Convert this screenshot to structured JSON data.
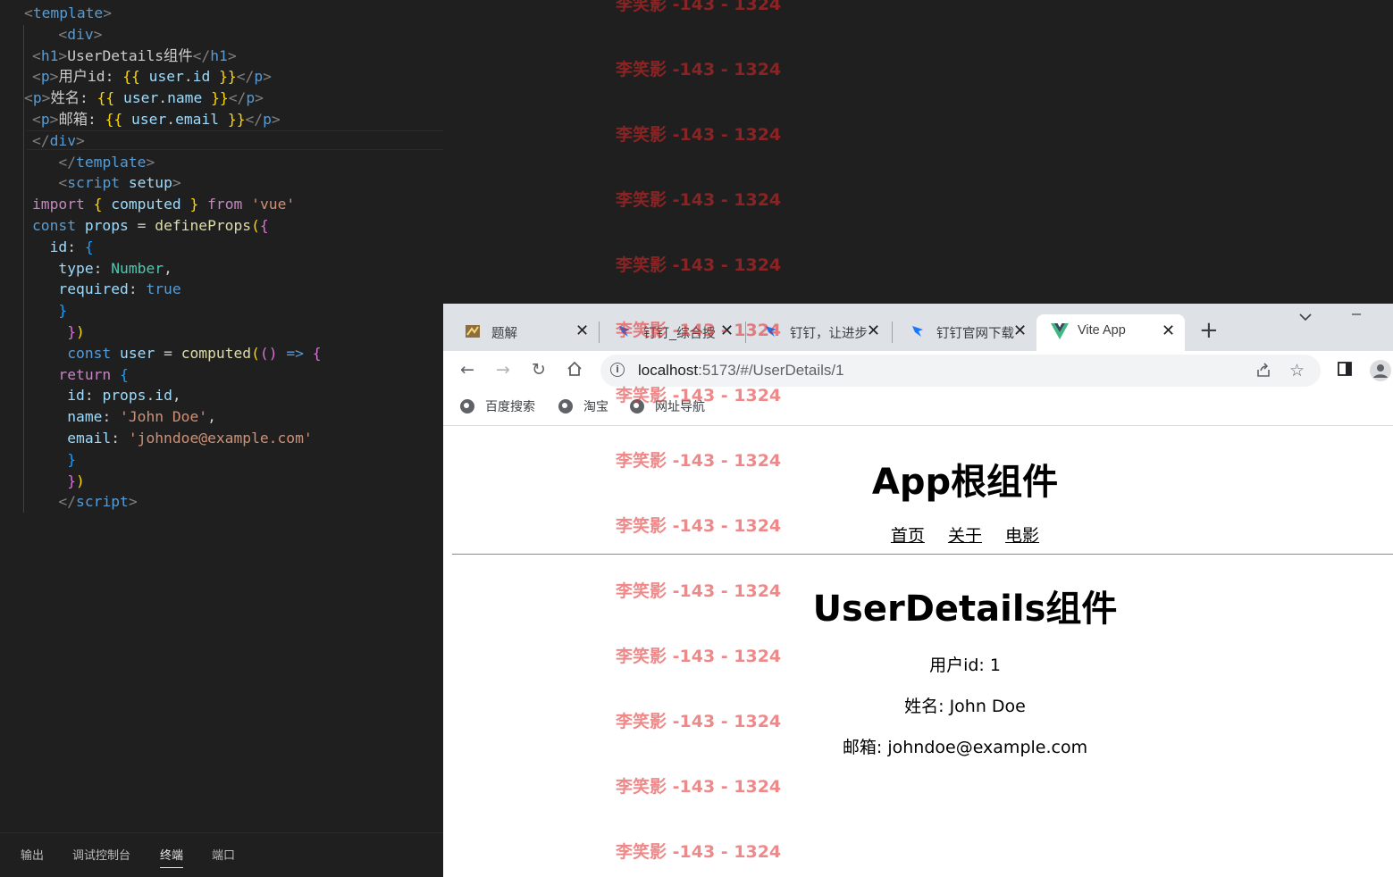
{
  "editor": {
    "lines": [
      [
        [
          "tok-punc",
          "<"
        ],
        [
          "tok-tag",
          "template"
        ],
        [
          "tok-punc",
          ">"
        ]
      ],
      [
        [
          "tok-text",
          "   "
        ],
        [
          "tok-punc",
          "<"
        ],
        [
          "tok-tag",
          "div"
        ],
        [
          "tok-punc",
          ">"
        ]
      ],
      [
        [
          "tok-punc",
          "<"
        ],
        [
          "tok-tag",
          "h1"
        ],
        [
          "tok-punc",
          ">"
        ],
        [
          "tok-text",
          "UserDetails组件"
        ],
        [
          "tok-punc",
          "</"
        ],
        [
          "tok-tag",
          "h1"
        ],
        [
          "tok-punc",
          ">"
        ]
      ],
      [
        [
          "tok-punc",
          "<"
        ],
        [
          "tok-tag",
          "p"
        ],
        [
          "tok-punc",
          ">"
        ],
        [
          "tok-text",
          "用户id: "
        ],
        [
          "tok-brace",
          "{{"
        ],
        [
          "tok-text",
          " "
        ],
        [
          "tok-var",
          "user"
        ],
        [
          "tok-text",
          "."
        ],
        [
          "tok-var",
          "id"
        ],
        [
          "tok-text",
          " "
        ],
        [
          "tok-brace",
          "}}"
        ],
        [
          "tok-punc",
          "</"
        ],
        [
          "tok-tag",
          "p"
        ],
        [
          "tok-punc",
          ">"
        ]
      ],
      [
        [
          "tok-punc",
          "<"
        ],
        [
          "tok-tag",
          "p"
        ],
        [
          "tok-punc",
          ">"
        ],
        [
          "tok-text",
          "姓名: "
        ],
        [
          "tok-brace",
          "{{"
        ],
        [
          "tok-text",
          " "
        ],
        [
          "tok-var",
          "user"
        ],
        [
          "tok-text",
          "."
        ],
        [
          "tok-var",
          "name"
        ],
        [
          "tok-text",
          " "
        ],
        [
          "tok-brace",
          "}}"
        ],
        [
          "tok-punc",
          "</"
        ],
        [
          "tok-tag",
          "p"
        ],
        [
          "tok-punc",
          ">"
        ]
      ],
      [
        [
          "tok-punc",
          "<"
        ],
        [
          "tok-tag",
          "p"
        ],
        [
          "tok-punc",
          ">"
        ],
        [
          "tok-text",
          "邮箱: "
        ],
        [
          "tok-brace",
          "{{"
        ],
        [
          "tok-text",
          " "
        ],
        [
          "tok-var",
          "user"
        ],
        [
          "tok-text",
          "."
        ],
        [
          "tok-var",
          "email"
        ],
        [
          "tok-text",
          " "
        ],
        [
          "tok-brace",
          "}}"
        ],
        [
          "tok-punc",
          "</"
        ],
        [
          "tok-tag",
          "p"
        ],
        [
          "tok-punc",
          ">"
        ]
      ],
      [
        [
          "tok-punc",
          "</"
        ],
        [
          "tok-tag",
          "div"
        ],
        [
          "tok-punc",
          ">"
        ]
      ],
      [
        [
          "tok-text",
          "   "
        ],
        [
          "tok-punc",
          "</"
        ],
        [
          "tok-tag",
          "template"
        ],
        [
          "tok-punc",
          ">"
        ]
      ],
      [
        [
          "tok-text",
          "   "
        ],
        [
          "tok-punc",
          "<"
        ],
        [
          "tok-tag",
          "script"
        ],
        [
          "tok-text",
          " "
        ],
        [
          "tok-attr",
          "setup"
        ],
        [
          "tok-punc",
          ">"
        ]
      ],
      [
        [
          "tok-kw",
          "import"
        ],
        [
          "tok-text",
          " "
        ],
        [
          "tok-brace",
          "{"
        ],
        [
          "tok-text",
          " "
        ],
        [
          "tok-var",
          "computed"
        ],
        [
          "tok-text",
          " "
        ],
        [
          "tok-brace",
          "}"
        ],
        [
          "tok-text",
          " "
        ],
        [
          "tok-kw",
          "from"
        ],
        [
          "tok-text",
          " "
        ],
        [
          "tok-str",
          "'vue'"
        ]
      ],
      [
        [
          "tok-const",
          "const"
        ],
        [
          "tok-text",
          " "
        ],
        [
          "tok-var",
          "props"
        ],
        [
          "tok-text",
          " = "
        ],
        [
          "tok-fn",
          "defineProps"
        ],
        [
          "tok-brace",
          "("
        ],
        [
          "tok-paren",
          "{"
        ]
      ],
      [
        [
          "tok-text",
          "  "
        ],
        [
          "tok-var",
          "id"
        ],
        [
          "tok-text",
          ": "
        ],
        [
          "tok-blue",
          "{"
        ]
      ],
      [
        [
          "tok-text",
          "   "
        ],
        [
          "tok-var",
          "type"
        ],
        [
          "tok-text",
          ": "
        ],
        [
          "tok-type",
          "Number"
        ],
        [
          "tok-text",
          ","
        ]
      ],
      [
        [
          "tok-text",
          "   "
        ],
        [
          "tok-var",
          "required"
        ],
        [
          "tok-text",
          ": "
        ],
        [
          "tok-const",
          "true"
        ]
      ],
      [
        [
          "tok-text",
          "   "
        ],
        [
          "tok-blue",
          "}"
        ]
      ],
      [
        [
          "tok-text",
          "    "
        ],
        [
          "tok-paren",
          "}"
        ],
        [
          "tok-brace",
          ")"
        ]
      ],
      [
        [
          "tok-text",
          "    "
        ],
        [
          "tok-const",
          "const"
        ],
        [
          "tok-text",
          " "
        ],
        [
          "tok-var",
          "user"
        ],
        [
          "tok-text",
          " = "
        ],
        [
          "tok-fn",
          "computed"
        ],
        [
          "tok-brace",
          "("
        ],
        [
          "tok-paren",
          "()"
        ],
        [
          "tok-text",
          " "
        ],
        [
          "tok-const",
          "=>"
        ],
        [
          "tok-text",
          " "
        ],
        [
          "tok-paren",
          "{"
        ]
      ],
      [
        [
          "tok-text",
          "   "
        ],
        [
          "tok-kw",
          "return"
        ],
        [
          "tok-text",
          " "
        ],
        [
          "tok-blue",
          "{"
        ]
      ],
      [
        [
          "tok-text",
          "    "
        ],
        [
          "tok-var",
          "id"
        ],
        [
          "tok-text",
          ": "
        ],
        [
          "tok-var",
          "props"
        ],
        [
          "tok-text",
          "."
        ],
        [
          "tok-var",
          "id"
        ],
        [
          "tok-text",
          ","
        ]
      ],
      [
        [
          "tok-text",
          "    "
        ],
        [
          "tok-var",
          "name"
        ],
        [
          "tok-text",
          ": "
        ],
        [
          "tok-str",
          "'John Doe'"
        ],
        [
          "tok-text",
          ","
        ]
      ],
      [
        [
          "tok-text",
          "    "
        ],
        [
          "tok-var",
          "email"
        ],
        [
          "tok-text",
          ": "
        ],
        [
          "tok-str",
          "'johndoe@example.com'"
        ]
      ],
      [
        [
          "tok-text",
          "    "
        ],
        [
          "tok-blue",
          "}"
        ]
      ],
      [
        [
          "tok-text",
          "    "
        ],
        [
          "tok-paren",
          "}"
        ],
        [
          "tok-brace",
          ")"
        ]
      ],
      [
        [
          "tok-text",
          "   "
        ],
        [
          "tok-punc",
          "</"
        ],
        [
          "tok-tag",
          "script"
        ],
        [
          "tok-punc",
          ">"
        ]
      ]
    ],
    "panel_tabs": [
      "输出",
      "调试控制台",
      "终端",
      "端口"
    ],
    "active_panel_tab": "终端"
  },
  "browser": {
    "tabs": [
      {
        "title": "题解",
        "icon": "problem-icon",
        "active": false
      },
      {
        "title": "钉钉_综合授",
        "icon": "dingtalk-icon",
        "active": false
      },
      {
        "title": "钉钉，让进步",
        "icon": "dingtalk-icon",
        "active": false
      },
      {
        "title": "钉钉官网下载",
        "icon": "dingtalk-icon",
        "active": false
      },
      {
        "title": "Vite App",
        "icon": "vite-icon",
        "active": true
      }
    ],
    "url_host": "localhost",
    "url_rest": ":5173/#/UserDetails/1",
    "bookmarks": [
      "百度搜索",
      "淘宝",
      "网址导航"
    ],
    "colors": {
      "tab_strip": "#dee1e6",
      "vite_green": "#41b883",
      "dingtalk_blue": "#1677ff"
    }
  },
  "page": {
    "app_title": "App根组件",
    "nav_links": [
      "首页",
      "关于",
      "电影"
    ],
    "details_title": "UserDetails组件",
    "user_id_line": "用户id: 1",
    "user_name_line": "姓名: John Doe",
    "user_email_line": "邮箱: johndoe@example.com"
  },
  "watermark": {
    "text": "李笑影 -143 - 1324",
    "color": "#e12828"
  }
}
